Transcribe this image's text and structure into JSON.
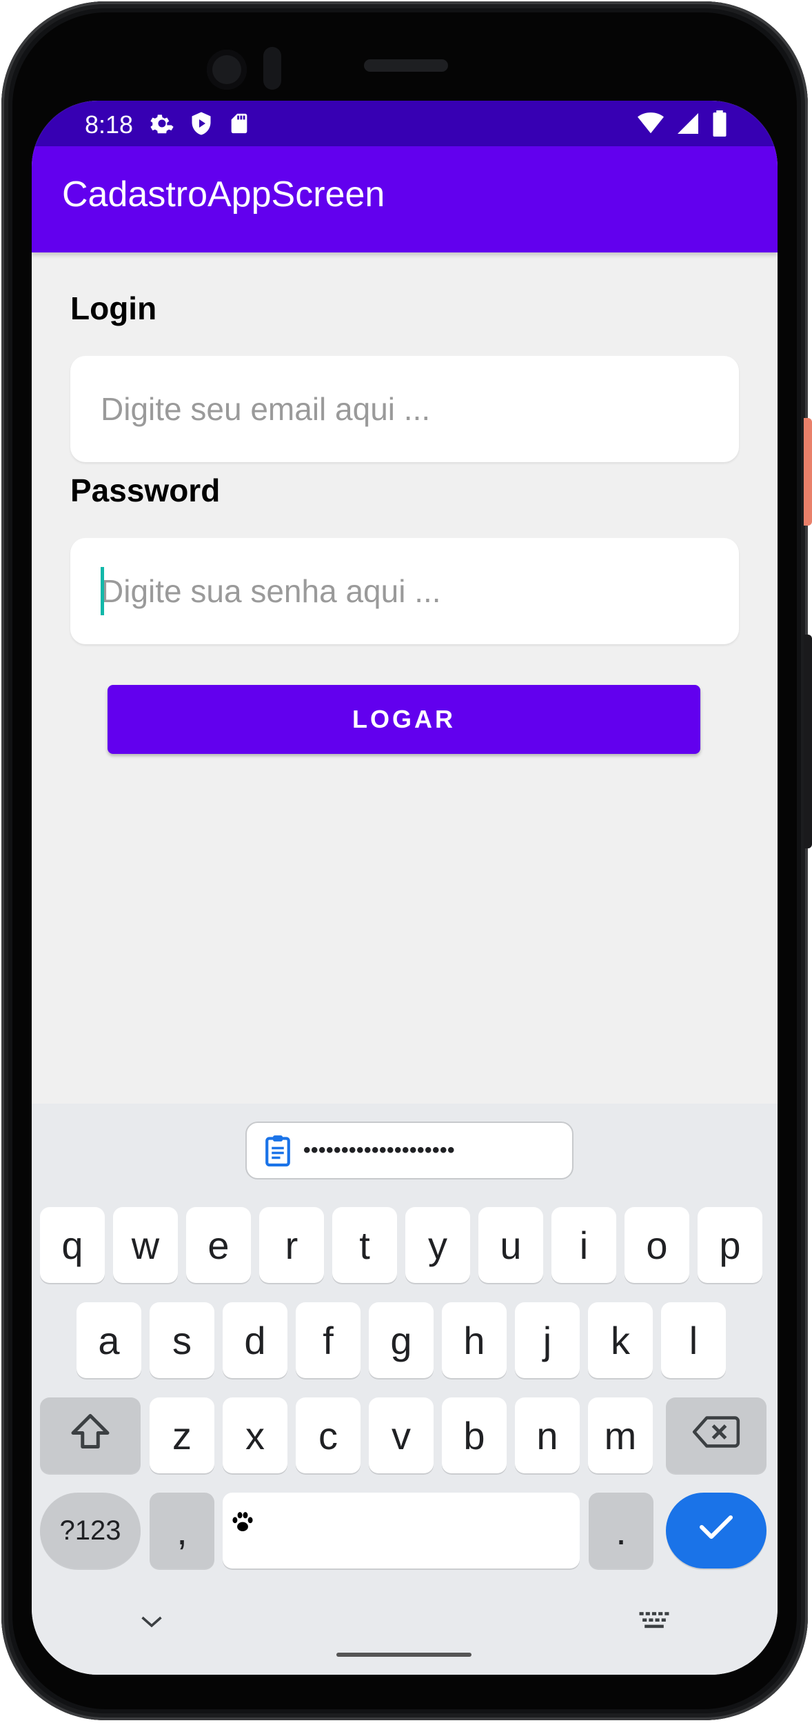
{
  "status_bar": {
    "time": "8:18",
    "left_icons": [
      "gear-icon",
      "shield-play-icon",
      "sd-card-icon"
    ],
    "right_icons": [
      "wifi-icon",
      "signal-icon",
      "battery-icon"
    ],
    "color": "#3700b3"
  },
  "app_bar": {
    "title": "CadastroAppScreen",
    "color": "#6200ee"
  },
  "form": {
    "login_label": "Login",
    "login_placeholder": "Digite seu email aqui ...",
    "password_label": "Password",
    "password_placeholder": "Digite sua senha aqui ...",
    "submit_label": "LOGAR"
  },
  "keyboard": {
    "suggestion": {
      "icon": "clipboard-icon",
      "text": "••••••••••••••••••••"
    },
    "row1": [
      "q",
      "w",
      "e",
      "r",
      "t",
      "y",
      "u",
      "i",
      "o",
      "p"
    ],
    "row2": [
      "a",
      "s",
      "d",
      "f",
      "g",
      "h",
      "j",
      "k",
      "l"
    ],
    "row3": [
      "z",
      "x",
      "c",
      "v",
      "b",
      "n",
      "m"
    ],
    "symbols_label": "?123",
    "comma_label": ",",
    "period_label": ".",
    "enter_color": "#1a73e8"
  }
}
